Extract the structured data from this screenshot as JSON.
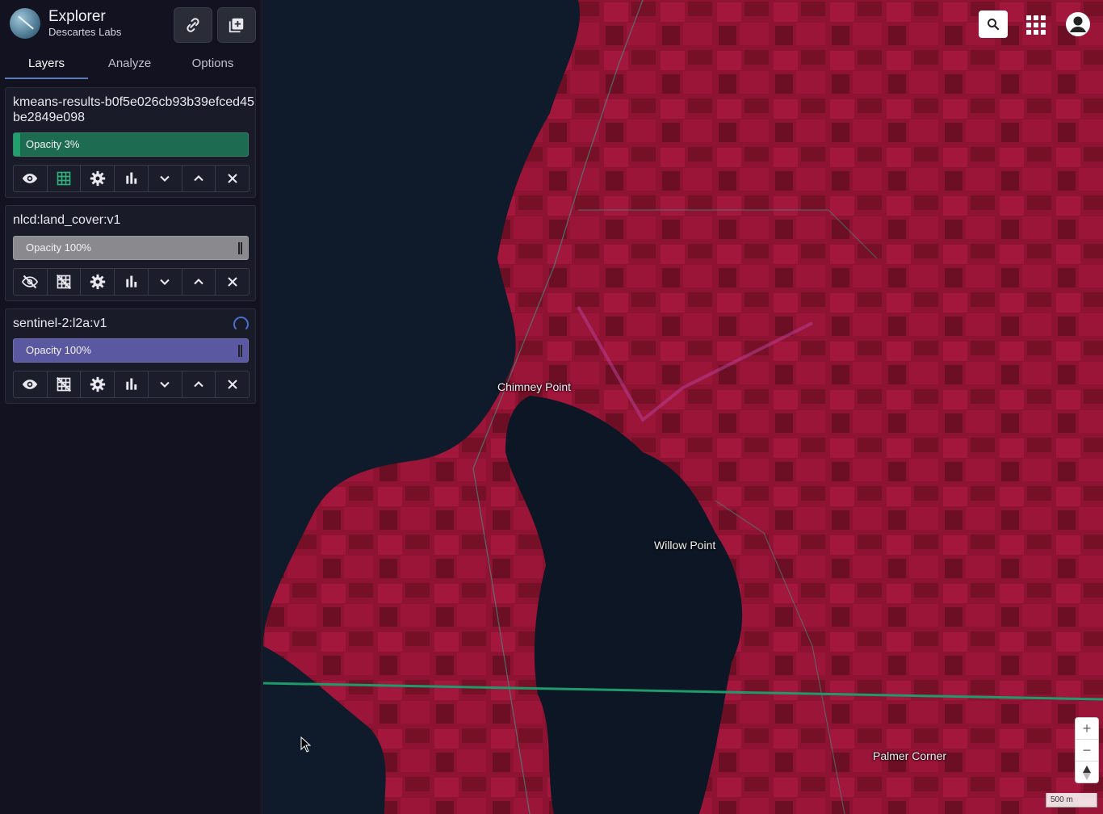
{
  "app": {
    "title": "Explorer",
    "subtitle": "Descartes Labs",
    "header_buttons": [
      {
        "name": "link-icon"
      },
      {
        "name": "add-layer-icon"
      }
    ]
  },
  "tabs": [
    {
      "label": "Layers",
      "active": true
    },
    {
      "label": "Analyze",
      "active": false
    },
    {
      "label": "Options",
      "active": false
    }
  ],
  "layers": [
    {
      "title": "kmeans-results-b0f5e026cb93b39efced45be2849e098",
      "opacity_label": "Opacity 3%",
      "opacity": 0.03,
      "color": "#1d6b50",
      "visible": true,
      "grid_active": true,
      "loading": false
    },
    {
      "title": "nlcd:land_cover:v1",
      "opacity_label": "Opacity 100%",
      "opacity": 1.0,
      "color": "#8a8a8e",
      "visible": false,
      "grid_active": false,
      "loading": false
    },
    {
      "title": "sentinel-2:l2a:v1",
      "opacity_label": "Opacity 100%",
      "opacity": 1.0,
      "color": "#5a58a0",
      "visible": true,
      "grid_active": false,
      "loading": true
    }
  ],
  "layer_tools": [
    "visibility-icon",
    "grid-icon",
    "settings-icon",
    "histogram-icon",
    "move-down-icon",
    "move-up-icon",
    "remove-icon"
  ],
  "map": {
    "places": [
      "Chimney Point",
      "Willow Point",
      "Palmer Corner"
    ],
    "scale_label": "500 m",
    "zoom_in": "+",
    "zoom_out": "−"
  },
  "colors": {
    "accent": "#5a7ab8",
    "map_land": "#8a1230",
    "map_water": "#0e1826",
    "boundary_line": "#1f9a6a"
  }
}
